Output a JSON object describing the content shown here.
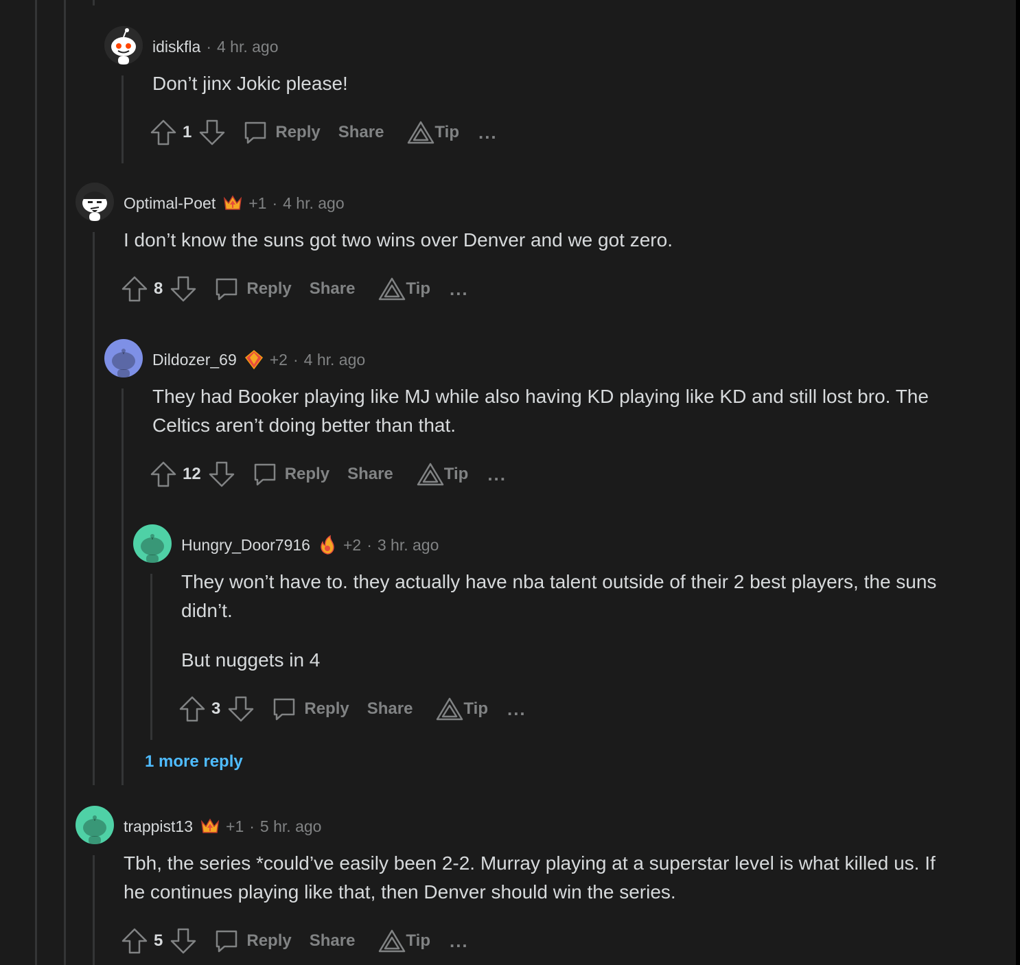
{
  "labels": {
    "reply": "Reply",
    "share": "Share",
    "tip": "Tip",
    "more": "..."
  },
  "comments": [
    {
      "username": "idiskfla",
      "sep": "·",
      "time": "4 hr. ago",
      "paragraphs": [
        "Don’t jinx Jokic please!"
      ],
      "score": "1",
      "avatar_icon": "snoo-avatar-icon"
    },
    {
      "username": "Optimal-Poet",
      "karma": "+1",
      "sep": "·",
      "time": "4 hr. ago",
      "paragraphs": [
        "I don’t know the suns got two wins over Denver and we got zero."
      ],
      "score": "8",
      "avatar_icon": "snoo-avatar-icon",
      "flair_icon": "crown-award-icon"
    },
    {
      "username": "Dildozer_69",
      "karma": "+2",
      "sep": "·",
      "time": "4 hr. ago",
      "paragraphs": [
        "They had Booker playing like MJ while also having KD playing like KD and still lost bro. The Celtics aren’t doing better than that."
      ],
      "score": "12",
      "avatar_icon": "default-snoo-icon",
      "avatar_color": "#7e90e6",
      "flair_icon": "gem-award-icon"
    },
    {
      "username": "Hungry_Door7916",
      "karma": "+2",
      "sep": "·",
      "time": "3 hr. ago",
      "paragraphs": [
        "They won’t have to. they actually have nba talent outside of their 2 best players, the suns didn’t.",
        "But nuggets in 4"
      ],
      "score": "3",
      "avatar_icon": "default-snoo-icon",
      "avatar_color": "#4fd1a6",
      "flair_icon": "fire-award-icon"
    },
    {
      "username": "trappist13",
      "karma": "+1",
      "sep": "·",
      "time": "5 hr. ago",
      "paragraphs": [
        "Tbh, the series *could’ve easily been 2-2. Murray playing at a superstar level is what killed us. If he continues playing like that, then Denver should win the series."
      ],
      "score": "5",
      "avatar_icon": "default-snoo-icon",
      "avatar_color": "#4fd1a6",
      "flair_icon": "crown-award-icon"
    }
  ],
  "more_replies": "1 more reply",
  "colors": {
    "background": "#1b1b1b",
    "text": "#d7dadc",
    "muted": "#818384",
    "link": "#4fbcff",
    "thread_line": "#343536"
  }
}
